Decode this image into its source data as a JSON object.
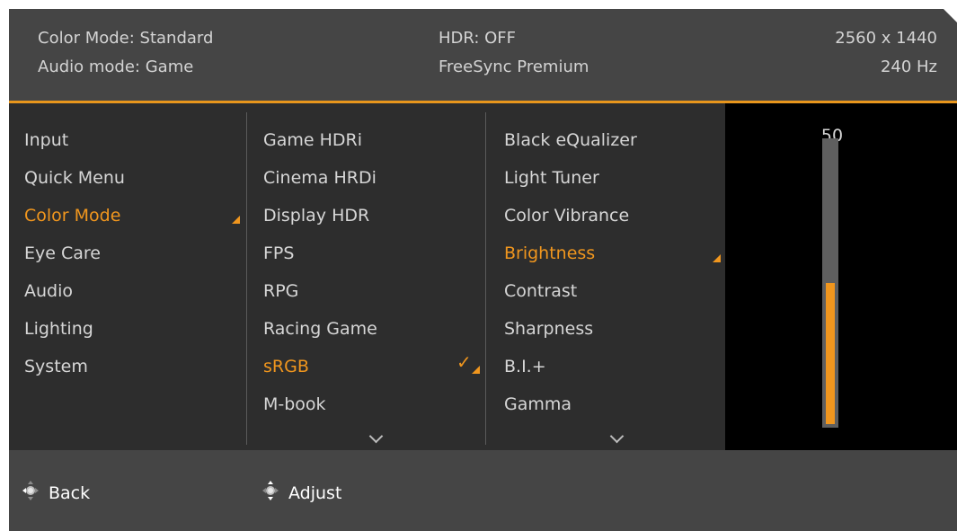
{
  "header": {
    "color_mode": "Color Mode: Standard",
    "audio_mode": "Audio mode: Game",
    "hdr": "HDR: OFF",
    "freesync": "FreeSync Premium",
    "resolution": "2560 x 1440",
    "refresh_rate": "240 Hz"
  },
  "menu_level1": {
    "items": [
      {
        "label": "Input"
      },
      {
        "label": "Quick Menu"
      },
      {
        "label": "Color Mode",
        "active": true
      },
      {
        "label": "Eye Care"
      },
      {
        "label": "Audio"
      },
      {
        "label": "Lighting"
      },
      {
        "label": "System"
      }
    ]
  },
  "menu_level2": {
    "items": [
      {
        "label": "Game HDRi"
      },
      {
        "label": "Cinema HRDi"
      },
      {
        "label": "Display HDR"
      },
      {
        "label": "FPS"
      },
      {
        "label": "RPG"
      },
      {
        "label": "Racing Game"
      },
      {
        "label": "sRGB",
        "active": true,
        "checked": true
      },
      {
        "label": "M-book"
      }
    ],
    "more_below": true
  },
  "menu_level3": {
    "items": [
      {
        "label": "Black eQualizer"
      },
      {
        "label": "Light Tuner"
      },
      {
        "label": "Color Vibrance"
      },
      {
        "label": "Brightness",
        "active": true
      },
      {
        "label": "Contrast"
      },
      {
        "label": "Sharpness"
      },
      {
        "label": "B.I.+"
      },
      {
        "label": "Gamma"
      }
    ],
    "more_below": true
  },
  "slider": {
    "value": "50",
    "level_fraction": 0.5,
    "fill_color": "#f0961e"
  },
  "footer": {
    "back_label": "Back",
    "adjust_label": "Adjust",
    "back_icon": "joystick-left-icon",
    "adjust_icon": "joystick-updown-icon"
  },
  "colors": {
    "accent": "#f0961e",
    "panel": "#2d2d2d",
    "header": "#454545"
  }
}
